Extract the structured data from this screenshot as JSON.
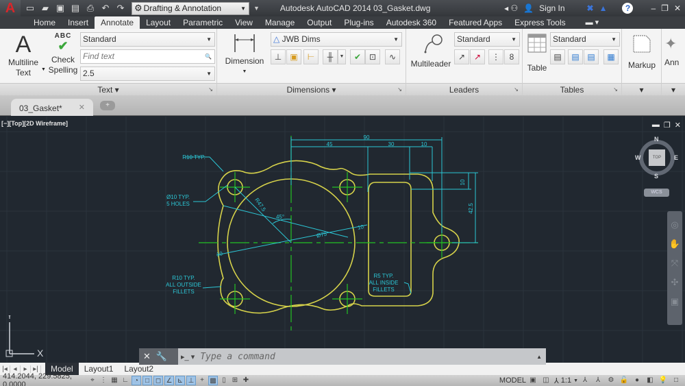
{
  "titlebar": {
    "app_icon": "autocad-logo-icon",
    "quick_access": [
      "new-icon",
      "open-icon",
      "save-icon",
      "save-as-icon",
      "plot-icon",
      "undo-icon",
      "redo-icon"
    ],
    "workspace": "Drafting & Annotation",
    "title": "Autodesk AutoCAD 2014    03_Gasket.dwg",
    "sign_in": "Sign In",
    "window_controls": [
      "minimize",
      "restore",
      "close"
    ]
  },
  "ribbon_tabs": [
    "Home",
    "Insert",
    "Annotate",
    "Layout",
    "Parametric",
    "View",
    "Manage",
    "Output",
    "Plug-ins",
    "Autodesk 360",
    "Featured Apps",
    "Express Tools"
  ],
  "active_tab": "Annotate",
  "panels": {
    "text": {
      "title": "Text",
      "multiline_text": "Multiline Text",
      "multiline_line1": "Multiline",
      "multiline_line2": "Text",
      "check_spelling_line1": "Check",
      "check_spelling_line2": "Spelling",
      "abc": "ABC",
      "style": "Standard",
      "find_placeholder": "Find text",
      "height": "2.5"
    },
    "dimensions": {
      "title": "Dimensions",
      "dimension": "Dimension",
      "style": "JWB Dims"
    },
    "leaders": {
      "title": "Leaders",
      "multileader": "Multileader",
      "style": "Standard"
    },
    "tables": {
      "title": "Tables",
      "table": "Table",
      "style": "Standard"
    },
    "markup": {
      "label": "Markup"
    },
    "annotation": {
      "label": "Ann"
    }
  },
  "file_tab": {
    "name": "03_Gasket*"
  },
  "viewport": {
    "label": "[−][Top][2D Wireframe]",
    "viewcube": {
      "face": "TOP",
      "n": "N",
      "s": "S",
      "e": "E",
      "w": "W"
    },
    "wcs": "WCS",
    "ucs_x": "X",
    "ucs_y": "Y"
  },
  "drawing": {
    "colors": {
      "geometry": "#d6d24a",
      "centerlines": "#23c323",
      "dimensions": "#2cc7d6",
      "background": "#212830"
    },
    "dims": {
      "d90": "90",
      "d45": "45",
      "d30": "30",
      "d10a": "10",
      "d10b": "10",
      "d42_5": "42.5",
      "r47_5": "R47.5",
      "ang45": "45°",
      "dia75": "Ø75",
      "d10c": "10",
      "d10d": "10"
    },
    "notes": {
      "r10_typ": "R10 TYP.",
      "holes_1": "Ø10 TYP.",
      "holes_2": "5 HOLES",
      "outside_1": "R10 TYP.",
      "outside_2": "ALL OUTSIDE",
      "outside_3": "FILLETS",
      "inside_1": "R5 TYP.",
      "inside_2": "ALL INSIDE",
      "inside_3": "FILLETS"
    }
  },
  "command_line": {
    "placeholder": "Type a command"
  },
  "layout_tabs": [
    "Model",
    "Layout1",
    "Layout2"
  ],
  "status": {
    "coordinates": "414.2044, 229.5825, 0.0000",
    "model": "MODEL",
    "scale": "1:1"
  }
}
